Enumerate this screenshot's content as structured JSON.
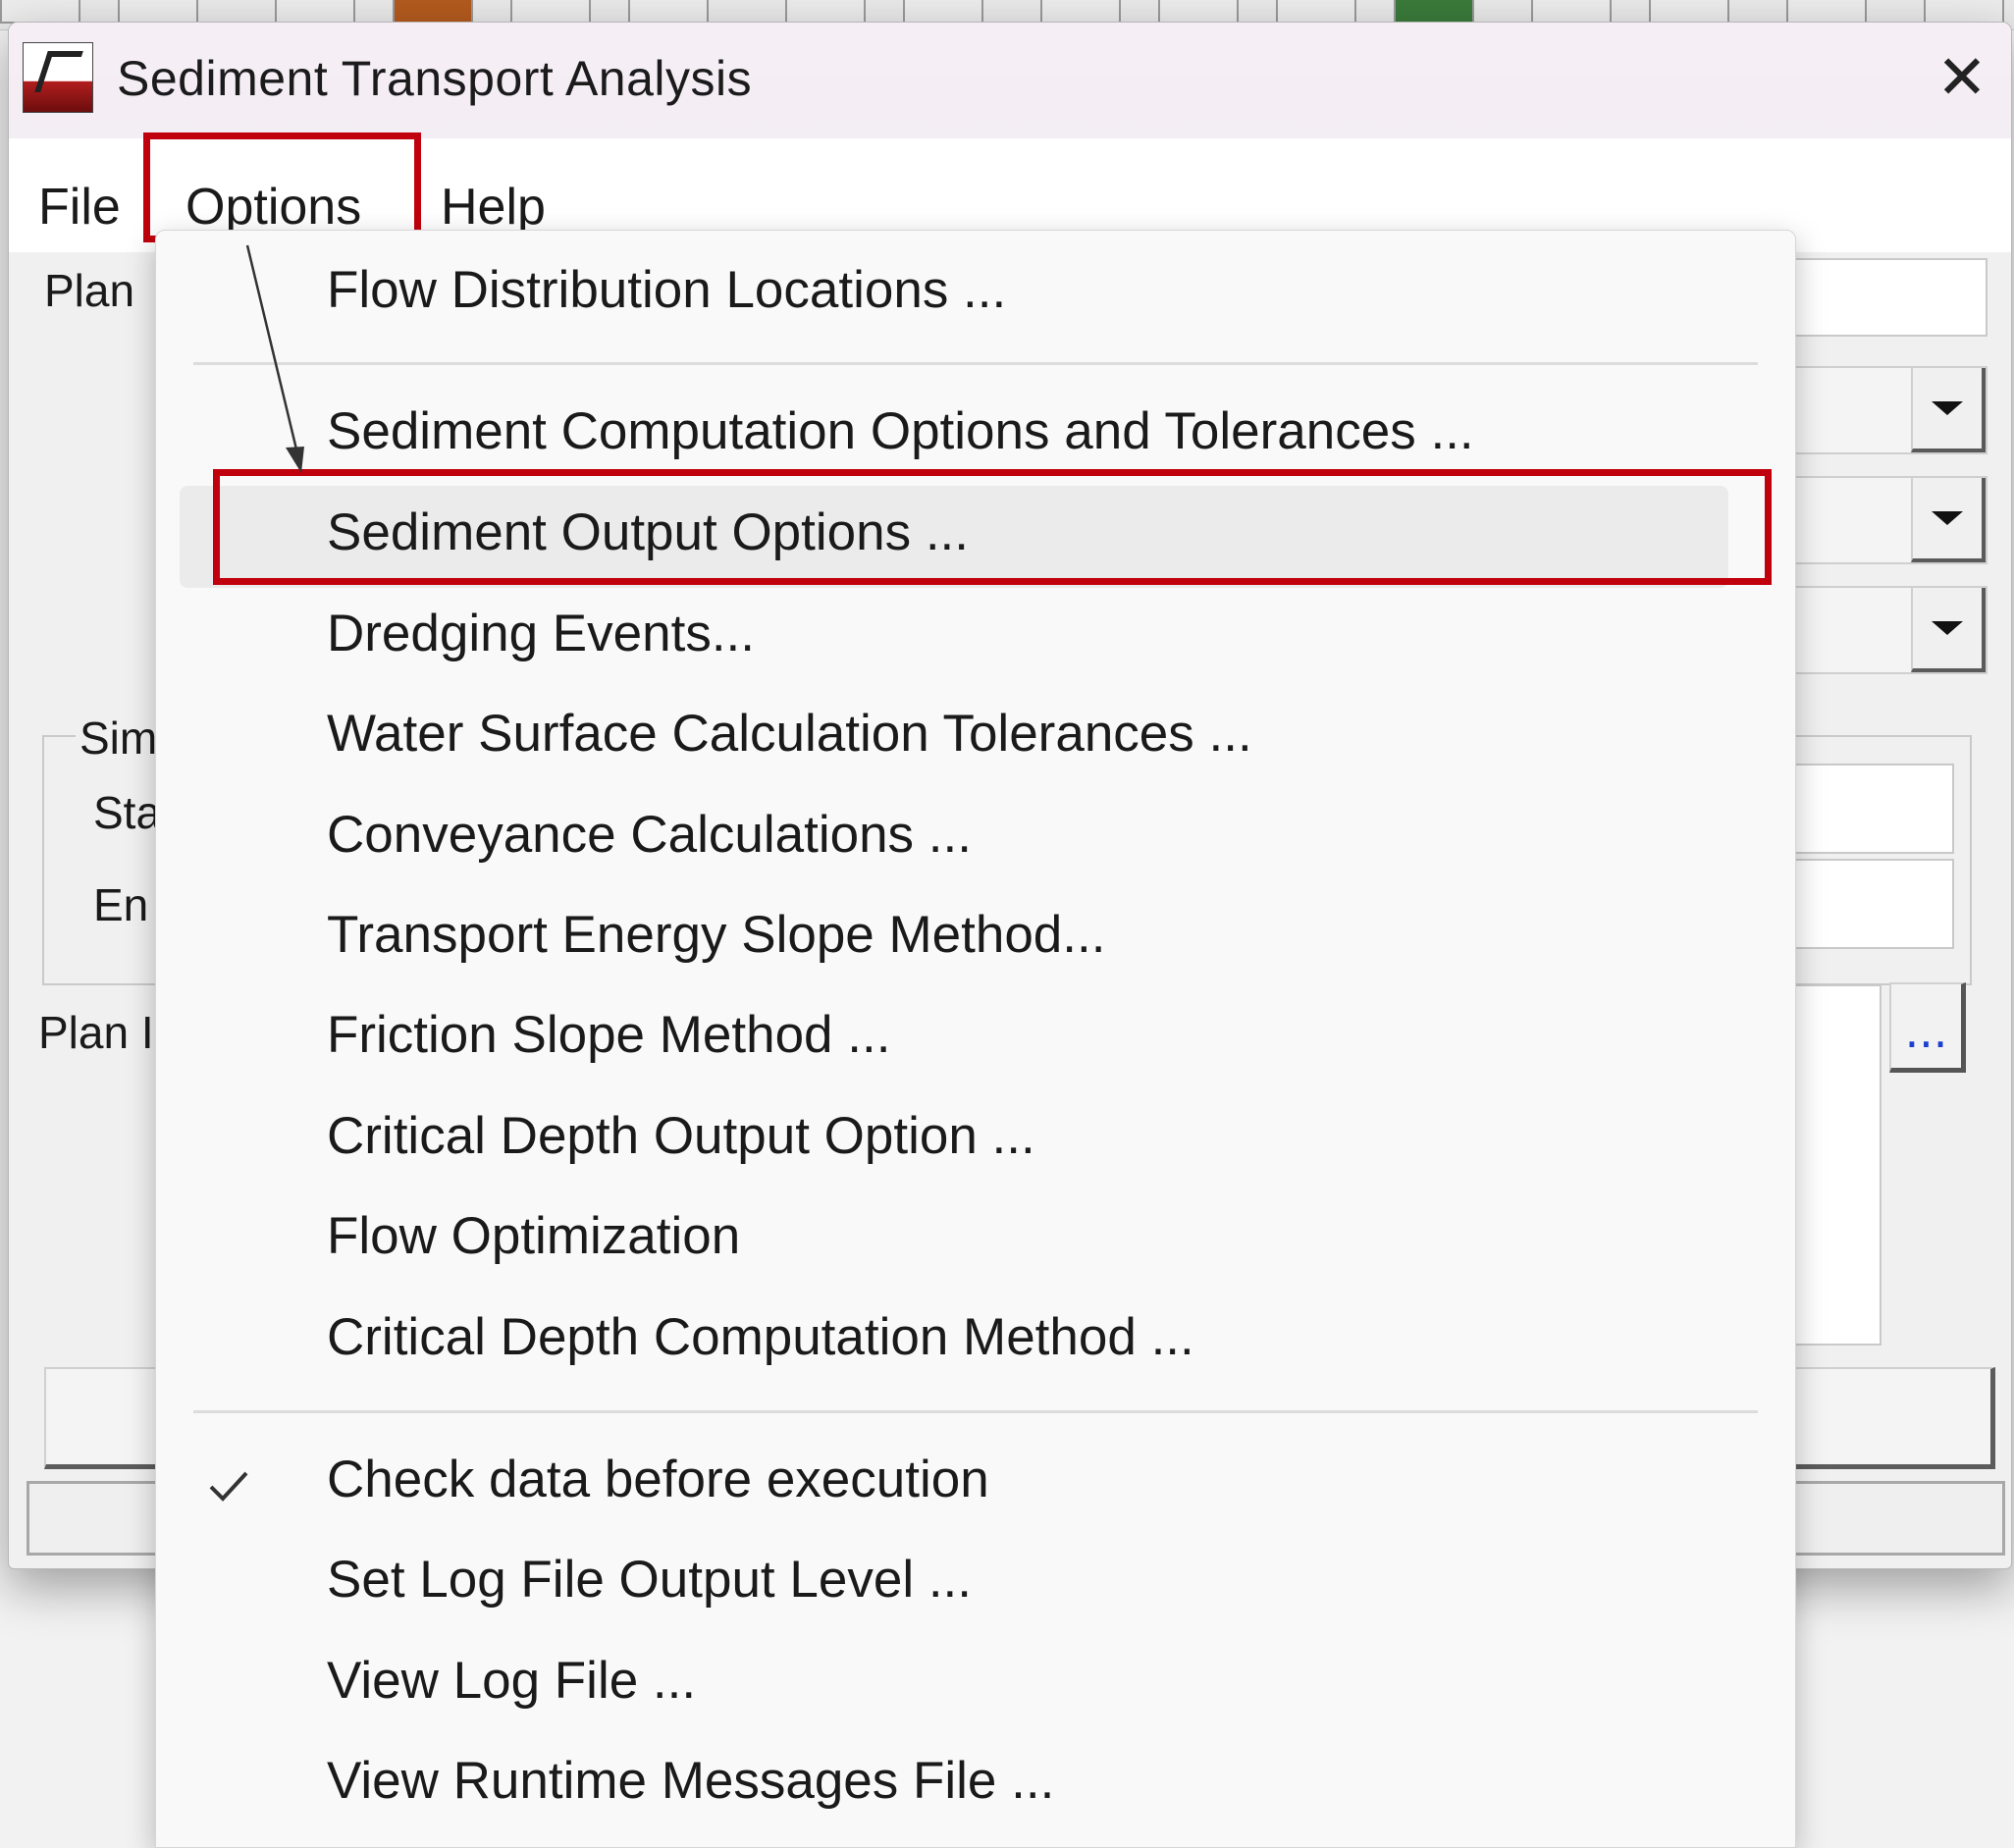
{
  "window": {
    "title": "Sediment Transport Analysis",
    "close_glyph": "✕"
  },
  "menubar": {
    "items": [
      "File",
      "Options",
      "Help"
    ]
  },
  "dialog_body": {
    "plan_label": "Plan",
    "sim_group_label": "Sim",
    "start_label": "Sta",
    "end_label": "En",
    "plan_desc_label": "Plan I",
    "ellipsis_button": "..."
  },
  "options_menu": {
    "items": [
      "Flow Distribution Locations ...",
      "Sediment Computation Options and Tolerances ...",
      "Sediment Output Options ...",
      "Dredging Events...",
      "Water Surface Calculation Tolerances ...",
      "Conveyance Calculations ...",
      "Transport Energy Slope Method...",
      "Friction Slope Method ...",
      "Critical Depth Output Option ...",
      "Flow Optimization",
      "Critical Depth Computation Method ...",
      "Check data before execution",
      "Set Log File Output Level ...",
      "View Log File ...",
      "View Runtime Messages File ..."
    ],
    "checked_item": "Check data before execution",
    "highlighted_item": "Sediment Output Options ..."
  },
  "colors": {
    "annotation_red": "#c0000c",
    "menu_background": "#f9f9f9",
    "titlebar": "#f6eef5"
  },
  "icons": {
    "app": "sediment-app-icon",
    "close": "close-icon",
    "check": "checkmark-icon",
    "dropdown": "chevron-down-icon"
  }
}
